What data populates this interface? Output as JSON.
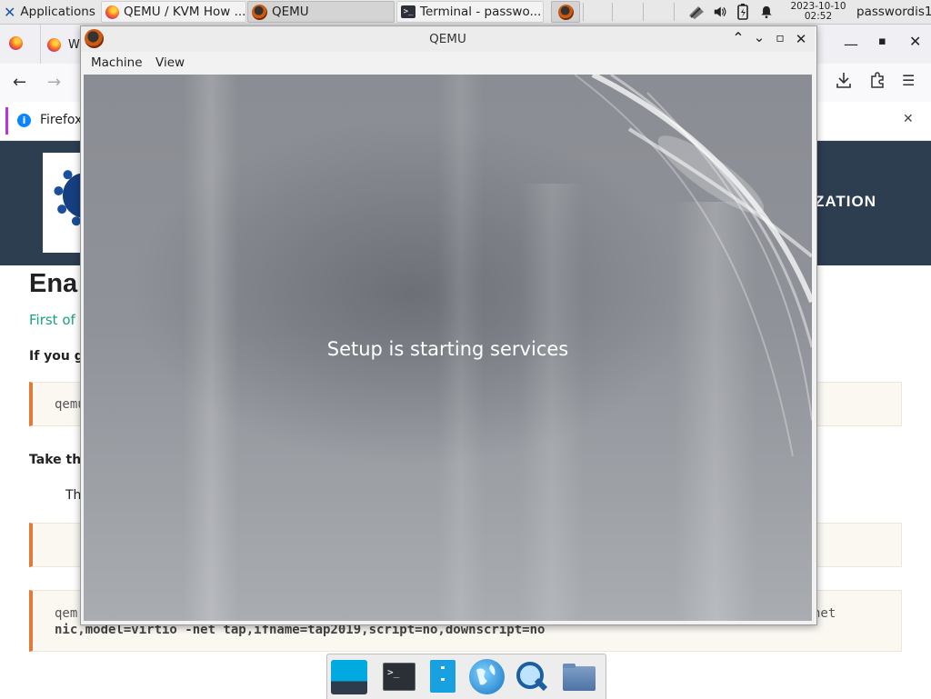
{
  "taskbar": {
    "applications_label": "Applications",
    "tasks": [
      {
        "label": "QEMU / KVM How ...",
        "icon": "firefox-icon"
      },
      {
        "label": "QEMU",
        "icon": "qemu-icon"
      },
      {
        "label": "Terminal - passwo...",
        "icon": "terminal-icon"
      }
    ],
    "clock_date": "2023-10-10",
    "clock_time": "02:52",
    "user": "passwordis1"
  },
  "firefox_background": {
    "tab_label": "W",
    "info_bar_text": "Firefox",
    "header_text": "ZATION",
    "heading": "Ena",
    "subheading": "First of a",
    "line_if_you": "If you ge",
    "code_1": "qemu",
    "line_take": "Take the",
    "para_th": "Th",
    "code_3_line1_start": "qem",
    "code_3_line1_end": "net",
    "code_3_line2": "nic,model=virtio -net tap,ifname=tap2019,script=no,downscript=no"
  },
  "qemu_window": {
    "title": "QEMU",
    "menu": [
      "Machine",
      "View"
    ],
    "screen_text": "Setup is starting services"
  },
  "dock": {
    "items": [
      "desktop-icon",
      "terminal-icon",
      "files-icon",
      "browser-icon",
      "app-finder-icon",
      "folder-icon"
    ]
  }
}
